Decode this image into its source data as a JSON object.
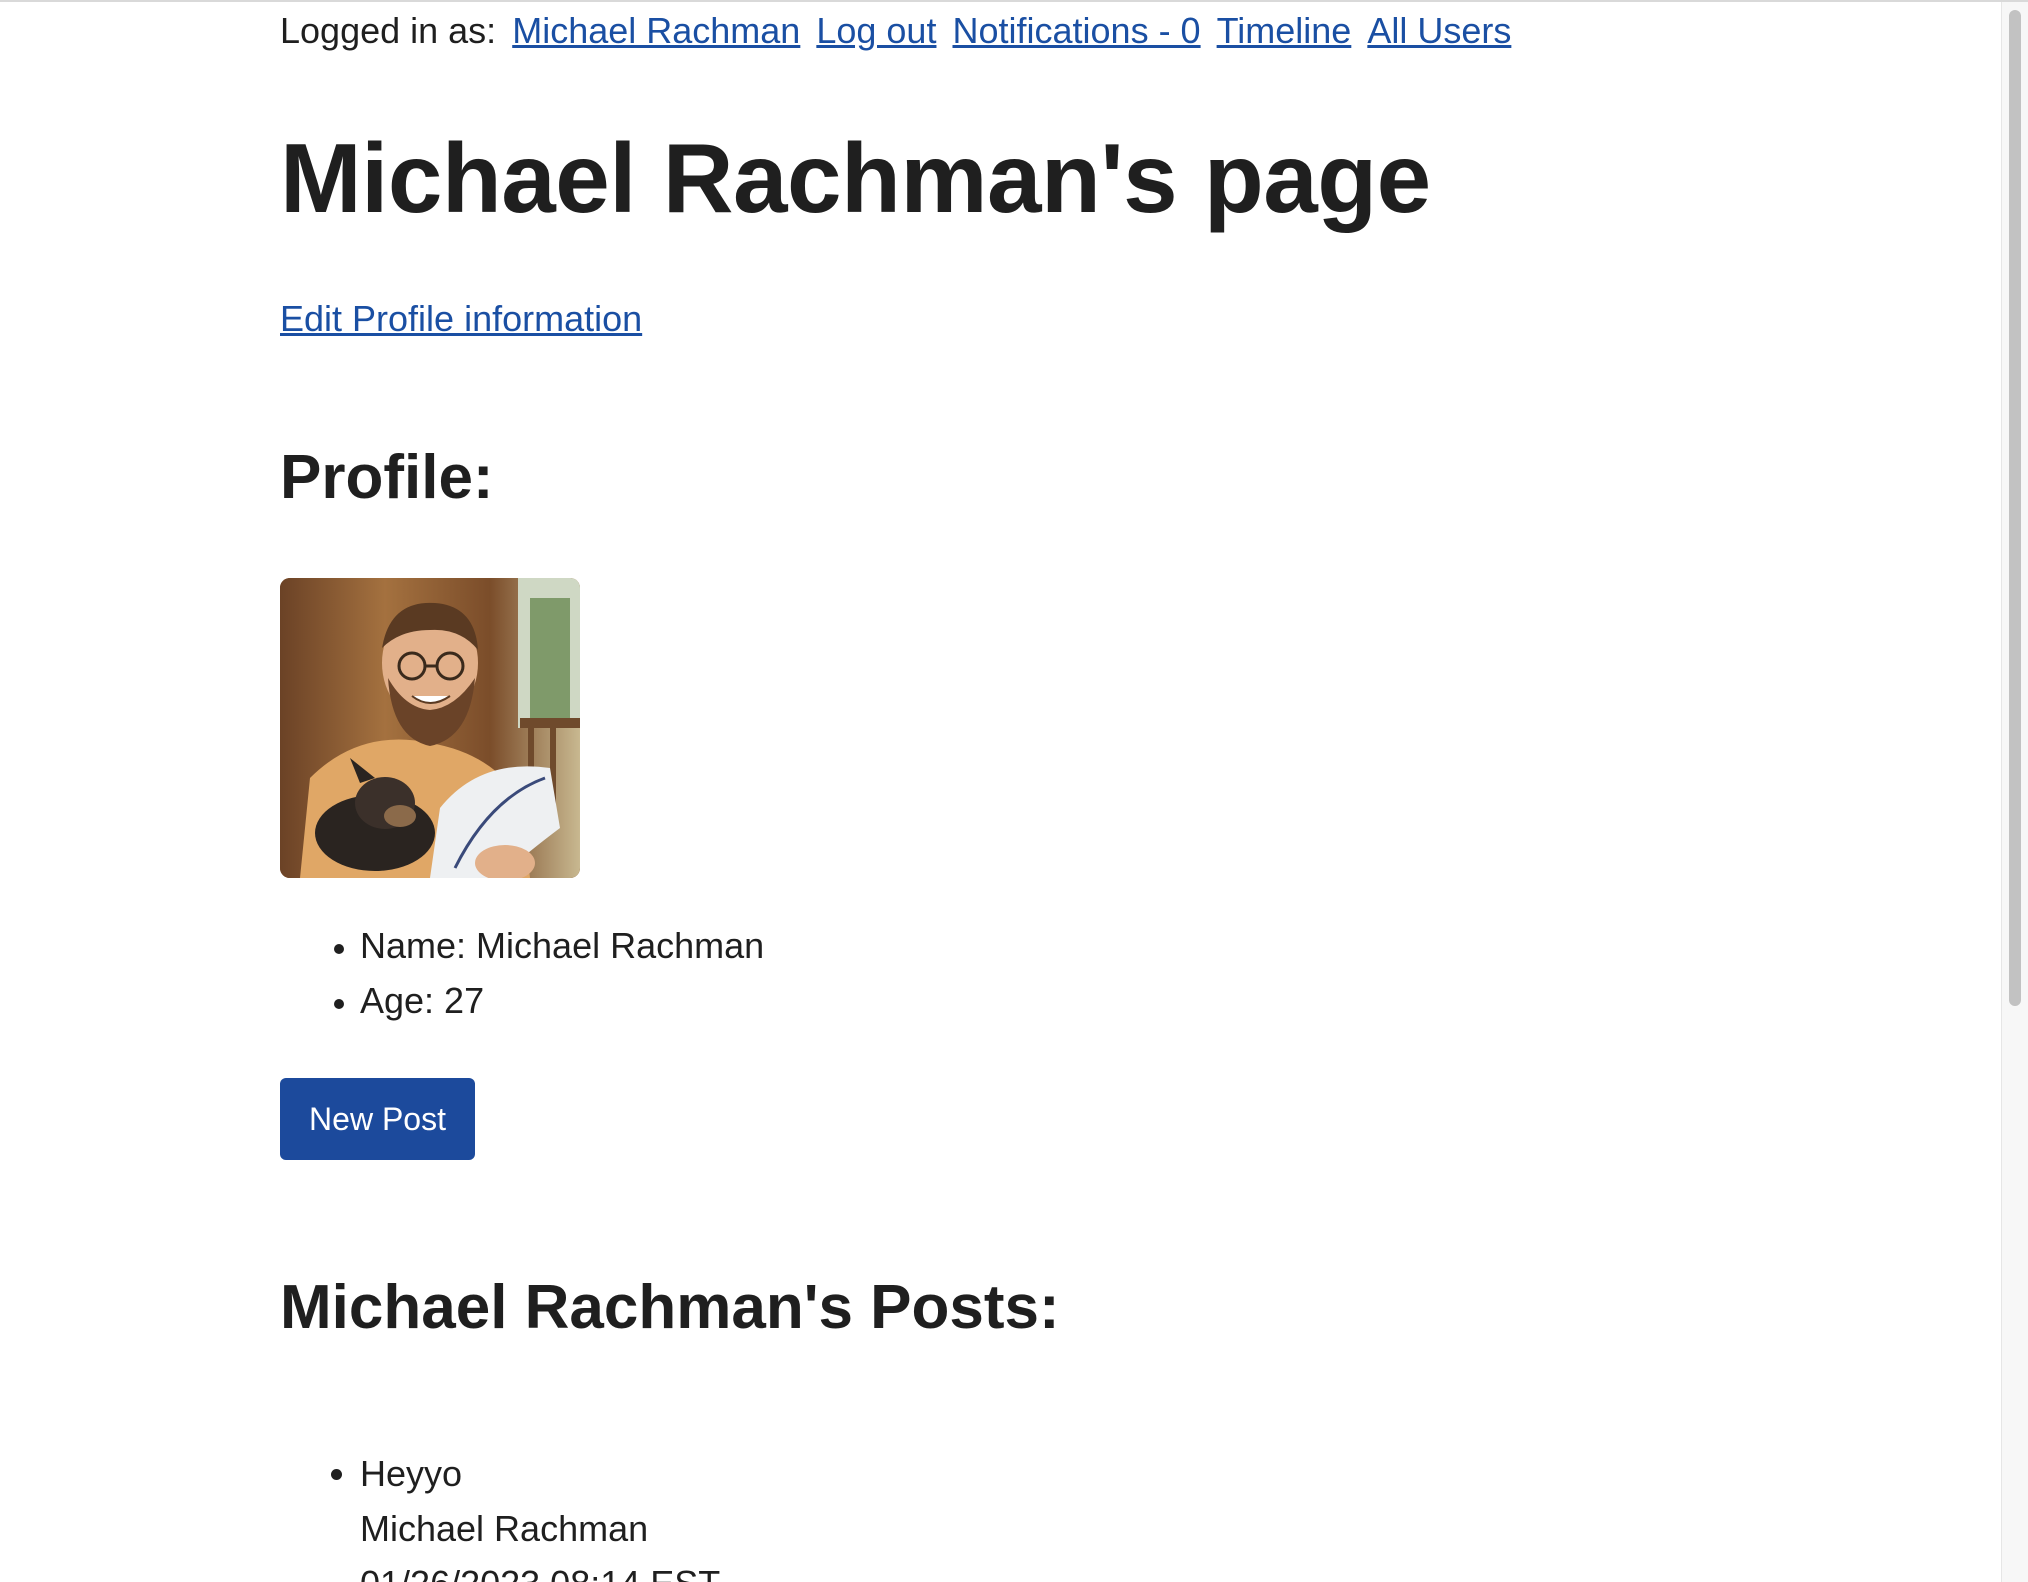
{
  "nav": {
    "logged_in_label": "Logged in as:",
    "user_link": "Michael Rachman",
    "logout_link": "Log out",
    "notifications_link": "Notifications - 0",
    "timeline_link": "Timeline",
    "all_users_link": "All Users"
  },
  "page_title": "Michael Rachman's page",
  "edit_profile_link": "Edit Profile information",
  "profile": {
    "heading": "Profile:",
    "name": "Name: Michael Rachman",
    "age": "Age: 27"
  },
  "new_post_button": "New Post",
  "posts": {
    "heading": "Michael Rachman's Posts:",
    "items": [
      {
        "text": "Heyyo",
        "author": "Michael Rachman",
        "timestamp": "01/26/2023 08:14 EST"
      }
    ]
  },
  "colors": {
    "link": "#1a4fa3",
    "button": "#1c4a9c"
  }
}
